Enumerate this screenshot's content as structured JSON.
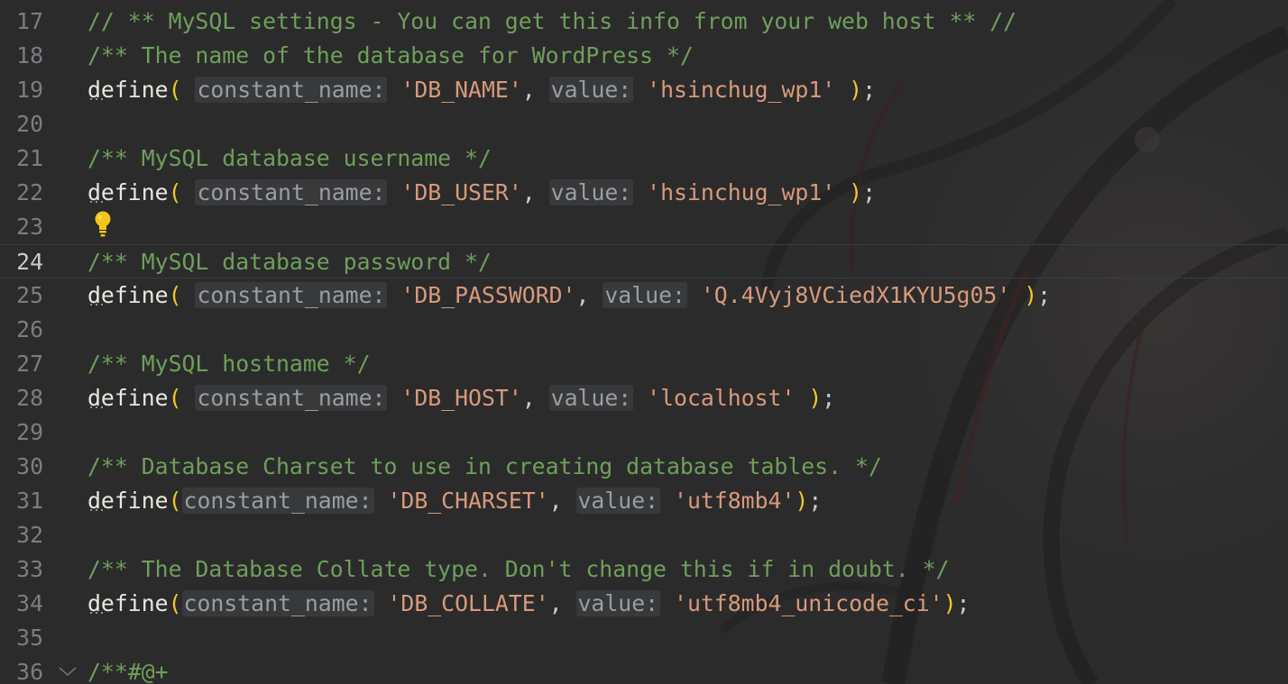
{
  "editor": {
    "lines": [
      {
        "num": "17",
        "comment": "// ** MySQL settings - You can get this info from your web host ** //"
      },
      {
        "num": "18",
        "comment": "/** The name of the database for WordPress */"
      },
      {
        "num": "19",
        "kw": "define",
        "open": "(",
        "hint1": "constant_name:",
        "s1": "'DB_NAME'",
        "comma": ",",
        "hint2": "value:",
        "s2": "'hsinchug_wp1'",
        "close": ")",
        "semi": ";"
      },
      {
        "num": "20"
      },
      {
        "num": "21",
        "comment": "/** MySQL database username */"
      },
      {
        "num": "22",
        "kw": "define",
        "open": "(",
        "hint1": "constant_name:",
        "s1": "'DB_USER'",
        "comma": ",",
        "hint2": "value:",
        "s2": "'hsinchug_wp1'",
        "close": ")",
        "semi": ";"
      },
      {
        "num": "23"
      },
      {
        "num": "24",
        "comment": "/** MySQL database password */"
      },
      {
        "num": "25",
        "kw": "define",
        "open": "(",
        "hint1": "constant_name:",
        "s1": "'DB_PASSWORD'",
        "comma": ",",
        "hint2": "value:",
        "s2": "'Q.4Vyj8VCiedX1KYU5g05'",
        "close": ")",
        "semi": ";"
      },
      {
        "num": "26"
      },
      {
        "num": "27",
        "comment": "/** MySQL hostname */"
      },
      {
        "num": "28",
        "kw": "define",
        "open": "(",
        "hint1": "constant_name:",
        "s1": "'DB_HOST'",
        "comma": ",",
        "hint2": "value:",
        "s2": "'localhost'",
        "close": ")",
        "semi": ";"
      },
      {
        "num": "29"
      },
      {
        "num": "30",
        "comment": "/** Database Charset to use in creating database tables. */"
      },
      {
        "num": "31",
        "kw": "define",
        "open": "(",
        "hint1": "constant_name:",
        "s1": "'DB_CHARSET'",
        "comma": ",",
        "hint2": "value:",
        "s2": "'utf8mb4'",
        "close": ")",
        "semi": ";"
      },
      {
        "num": "32"
      },
      {
        "num": "33",
        "comment": "/** The Database Collate type. Don't change this if in doubt. */"
      },
      {
        "num": "34",
        "kw": "define",
        "open": "(",
        "hint1": "constant_name:",
        "s1": "'DB_COLLATE'",
        "comma": ",",
        "hint2": "value:",
        "s2": "'utf8mb4_unicode_ci'",
        "close": ")",
        "semi": ";"
      },
      {
        "num": "35"
      },
      {
        "num": "36",
        "comment": "/**#@+"
      }
    ],
    "current_line": "24",
    "icons": {
      "intention": "lightbulb-icon",
      "fold": "fold-chevron-icon"
    },
    "colors": {
      "background": "#2b2b2c",
      "comment": "#6f9f5a",
      "string": "#d89a7a",
      "paren": "#f0c82a",
      "hint": "#9a9da2",
      "line_number": "#7a7d82",
      "bulb": "#f2c618"
    }
  }
}
